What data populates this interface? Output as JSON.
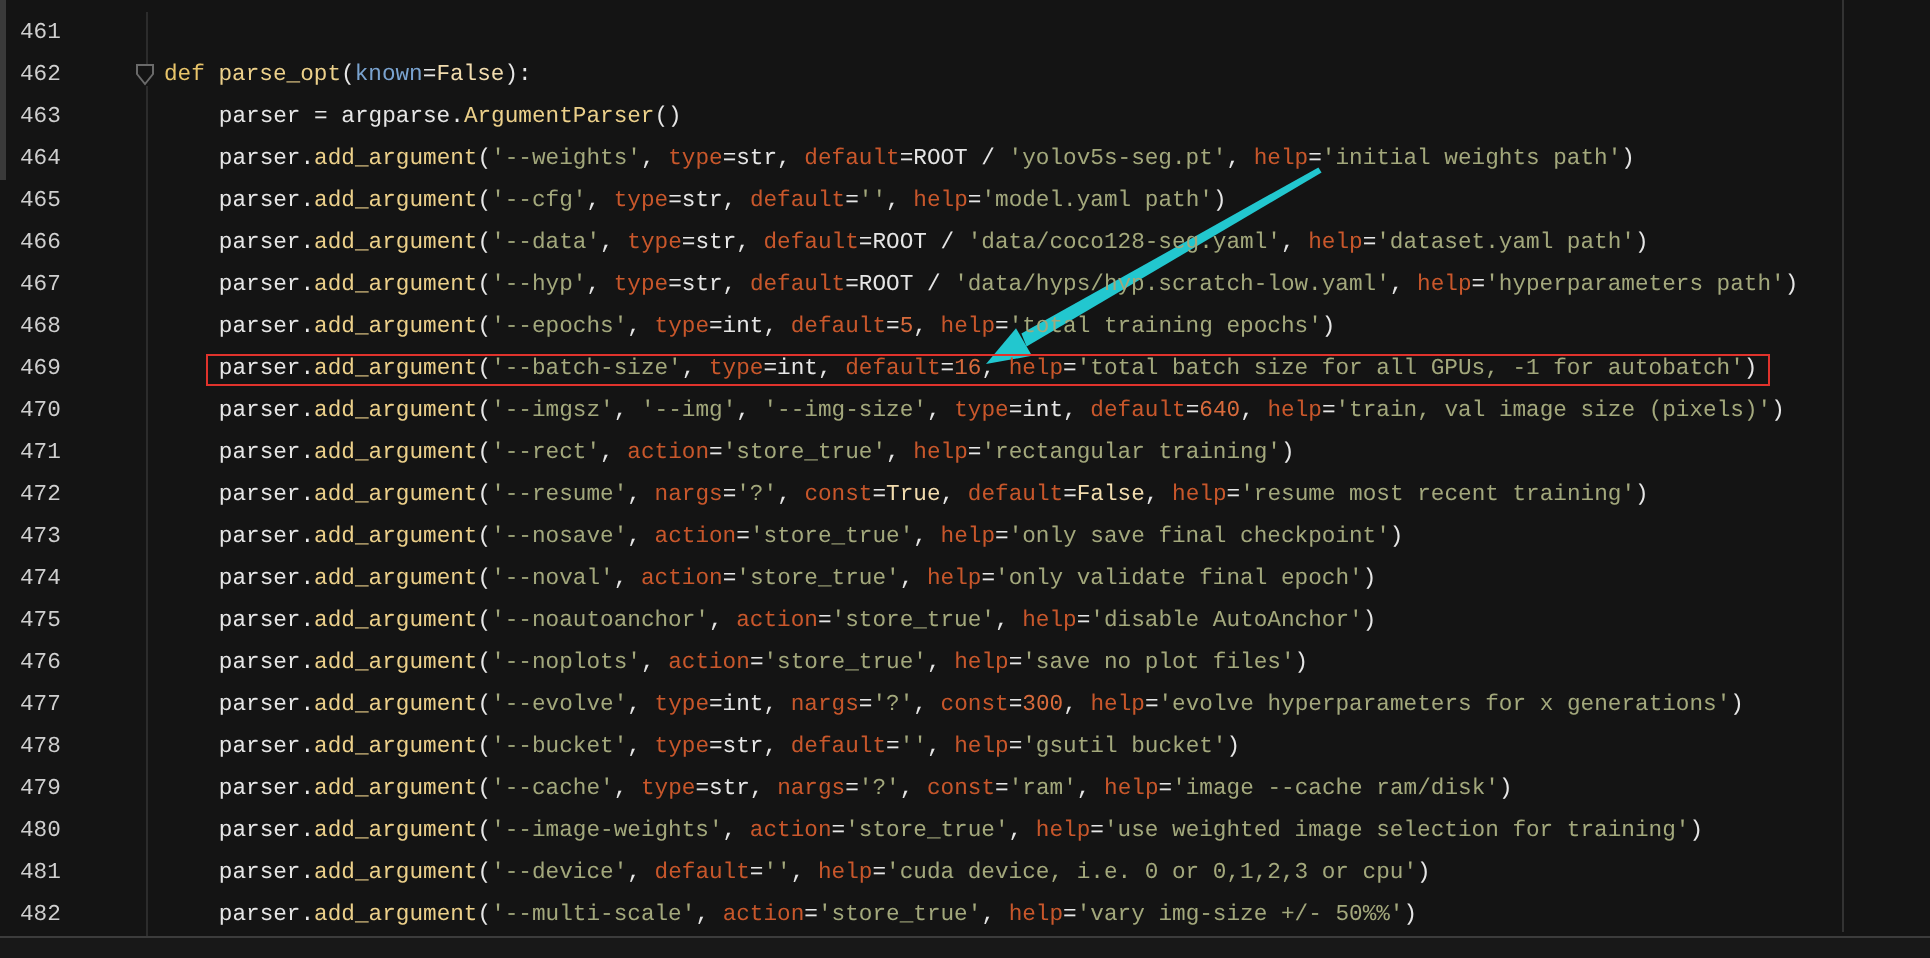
{
  "editor": {
    "lines": [
      {
        "number": "461"
      },
      {
        "number": "462",
        "highlighted": false,
        "foldable": true,
        "tokens": [
          {
            "kind": "keyword",
            "text": "def "
          },
          {
            "kind": "func",
            "text": "parse_opt"
          },
          {
            "kind": "plain",
            "text": "("
          },
          {
            "kind": "arg",
            "text": "known"
          },
          {
            "kind": "plain",
            "text": "="
          },
          {
            "kind": "const",
            "text": "False"
          },
          {
            "kind": "plain",
            "text": "):"
          }
        ],
        "children": [
          {
            "number": "463",
            "highlighted": false,
            "tokens": [
              {
                "kind": "plain",
                "text": "parser = argparse."
              },
              {
                "kind": "func",
                "text": "ArgumentParser"
              },
              {
                "kind": "plain",
                "text": "()"
              }
            ]
          },
          {
            "number": "464",
            "highlighted": false,
            "tokens": [
              {
                "kind": "plain",
                "text": "parser."
              },
              {
                "kind": "func",
                "text": "add_argument"
              },
              {
                "kind": "plain",
                "text": "("
              },
              {
                "kind": "string",
                "text": "'--weights'"
              },
              {
                "kind": "plain",
                "text": ", "
              },
              {
                "kind": "param",
                "text": "type"
              },
              {
                "kind": "plain",
                "text": "=str, "
              },
              {
                "kind": "param",
                "text": "default"
              },
              {
                "kind": "plain",
                "text": "=ROOT / "
              },
              {
                "kind": "string",
                "text": "'yolov5s-seg.pt'"
              },
              {
                "kind": "plain",
                "text": ", "
              },
              {
                "kind": "param",
                "text": "help"
              },
              {
                "kind": "plain",
                "text": "="
              },
              {
                "kind": "string",
                "text": "'initial weights path'"
              },
              {
                "kind": "plain",
                "text": ")"
              }
            ]
          },
          {
            "number": "465",
            "highlighted": false,
            "tokens": [
              {
                "kind": "plain",
                "text": "parser."
              },
              {
                "kind": "func",
                "text": "add_argument"
              },
              {
                "kind": "plain",
                "text": "("
              },
              {
                "kind": "string",
                "text": "'--cfg'"
              },
              {
                "kind": "plain",
                "text": ", "
              },
              {
                "kind": "param",
                "text": "type"
              },
              {
                "kind": "plain",
                "text": "=str, "
              },
              {
                "kind": "param",
                "text": "default"
              },
              {
                "kind": "plain",
                "text": "="
              },
              {
                "kind": "string",
                "text": "''"
              },
              {
                "kind": "plain",
                "text": ", "
              },
              {
                "kind": "param",
                "text": "help"
              },
              {
                "kind": "plain",
                "text": "="
              },
              {
                "kind": "string",
                "text": "'model.yaml path'"
              },
              {
                "kind": "plain",
                "text": ")"
              }
            ]
          },
          {
            "number": "466",
            "highlighted": false,
            "tokens": [
              {
                "kind": "plain",
                "text": "parser."
              },
              {
                "kind": "func",
                "text": "add_argument"
              },
              {
                "kind": "plain",
                "text": "("
              },
              {
                "kind": "string",
                "text": "'--data'"
              },
              {
                "kind": "plain",
                "text": ", "
              },
              {
                "kind": "param",
                "text": "type"
              },
              {
                "kind": "plain",
                "text": "=str, "
              },
              {
                "kind": "param",
                "text": "default"
              },
              {
                "kind": "plain",
                "text": "=ROOT / "
              },
              {
                "kind": "string",
                "text": "'data/coco128-seg.yaml'"
              },
              {
                "kind": "plain",
                "text": ", "
              },
              {
                "kind": "param",
                "text": "help"
              },
              {
                "kind": "plain",
                "text": "="
              },
              {
                "kind": "string",
                "text": "'dataset.yaml path'"
              },
              {
                "kind": "plain",
                "text": ")"
              }
            ]
          },
          {
            "number": "467",
            "highlighted": false,
            "tokens": [
              {
                "kind": "plain",
                "text": "parser."
              },
              {
                "kind": "func",
                "text": "add_argument"
              },
              {
                "kind": "plain",
                "text": "("
              },
              {
                "kind": "string",
                "text": "'--hyp'"
              },
              {
                "kind": "plain",
                "text": ", "
              },
              {
                "kind": "param",
                "text": "type"
              },
              {
                "kind": "plain",
                "text": "=str, "
              },
              {
                "kind": "param",
                "text": "default"
              },
              {
                "kind": "plain",
                "text": "=ROOT / "
              },
              {
                "kind": "string",
                "text": "'data/hyps/hyp.scratch-low.yaml'"
              },
              {
                "kind": "plain",
                "text": ", "
              },
              {
                "kind": "param",
                "text": "help"
              },
              {
                "kind": "plain",
                "text": "="
              },
              {
                "kind": "string",
                "text": "'hyperparameters path'"
              },
              {
                "kind": "plain",
                "text": ")"
              }
            ]
          },
          {
            "number": "468",
            "highlighted": false,
            "tokens": [
              {
                "kind": "plain",
                "text": "parser."
              },
              {
                "kind": "func",
                "text": "add_argument"
              },
              {
                "kind": "plain",
                "text": "("
              },
              {
                "kind": "string",
                "text": "'--epochs'"
              },
              {
                "kind": "plain",
                "text": ", "
              },
              {
                "kind": "param",
                "text": "type"
              },
              {
                "kind": "plain",
                "text": "=int, "
              },
              {
                "kind": "param",
                "text": "default"
              },
              {
                "kind": "plain",
                "text": "="
              },
              {
                "kind": "number",
                "text": "5"
              },
              {
                "kind": "plain",
                "text": ", "
              },
              {
                "kind": "param",
                "text": "help"
              },
              {
                "kind": "plain",
                "text": "="
              },
              {
                "kind": "string",
                "text": "'total training epochs'"
              },
              {
                "kind": "plain",
                "text": ")"
              }
            ]
          },
          {
            "number": "469",
            "highlighted": true,
            "tokens": [
              {
                "kind": "plain",
                "text": "parser."
              },
              {
                "kind": "func",
                "text": "add_argument"
              },
              {
                "kind": "plain",
                "text": "("
              },
              {
                "kind": "string",
                "text": "'--batch-size'"
              },
              {
                "kind": "plain",
                "text": ", "
              },
              {
                "kind": "param",
                "text": "type"
              },
              {
                "kind": "plain",
                "text": "=int, "
              },
              {
                "kind": "param",
                "text": "default"
              },
              {
                "kind": "plain",
                "text": "="
              },
              {
                "kind": "number",
                "text": "16"
              },
              {
                "kind": "plain",
                "text": ", "
              },
              {
                "kind": "param",
                "text": "help"
              },
              {
                "kind": "plain",
                "text": "="
              },
              {
                "kind": "string",
                "text": "'total batch size for all GPUs, -1 for autobatch'"
              },
              {
                "kind": "plain",
                "text": ")"
              }
            ]
          },
          {
            "number": "470",
            "highlighted": false,
            "tokens": [
              {
                "kind": "plain",
                "text": "parser."
              },
              {
                "kind": "func",
                "text": "add_argument"
              },
              {
                "kind": "plain",
                "text": "("
              },
              {
                "kind": "string",
                "text": "'--imgsz'"
              },
              {
                "kind": "plain",
                "text": ", "
              },
              {
                "kind": "string",
                "text": "'--img'"
              },
              {
                "kind": "plain",
                "text": ", "
              },
              {
                "kind": "string",
                "text": "'--img-size'"
              },
              {
                "kind": "plain",
                "text": ", "
              },
              {
                "kind": "param",
                "text": "type"
              },
              {
                "kind": "plain",
                "text": "=int, "
              },
              {
                "kind": "param",
                "text": "default"
              },
              {
                "kind": "plain",
                "text": "="
              },
              {
                "kind": "number",
                "text": "640"
              },
              {
                "kind": "plain",
                "text": ", "
              },
              {
                "kind": "param",
                "text": "help"
              },
              {
                "kind": "plain",
                "text": "="
              },
              {
                "kind": "string",
                "text": "'train, val image size (pixels)'"
              },
              {
                "kind": "plain",
                "text": ")"
              }
            ]
          },
          {
            "number": "471",
            "highlighted": false,
            "tokens": [
              {
                "kind": "plain",
                "text": "parser."
              },
              {
                "kind": "func",
                "text": "add_argument"
              },
              {
                "kind": "plain",
                "text": "("
              },
              {
                "kind": "string",
                "text": "'--rect'"
              },
              {
                "kind": "plain",
                "text": ", "
              },
              {
                "kind": "param",
                "text": "action"
              },
              {
                "kind": "plain",
                "text": "="
              },
              {
                "kind": "string",
                "text": "'store_true'"
              },
              {
                "kind": "plain",
                "text": ", "
              },
              {
                "kind": "param",
                "text": "help"
              },
              {
                "kind": "plain",
                "text": "="
              },
              {
                "kind": "string",
                "text": "'rectangular training'"
              },
              {
                "kind": "plain",
                "text": ")"
              }
            ]
          },
          {
            "number": "472",
            "highlighted": false,
            "tokens": [
              {
                "kind": "plain",
                "text": "parser."
              },
              {
                "kind": "func",
                "text": "add_argument"
              },
              {
                "kind": "plain",
                "text": "("
              },
              {
                "kind": "string",
                "text": "'--resume'"
              },
              {
                "kind": "plain",
                "text": ", "
              },
              {
                "kind": "param",
                "text": "nargs"
              },
              {
                "kind": "plain",
                "text": "="
              },
              {
                "kind": "string",
                "text": "'?'"
              },
              {
                "kind": "plain",
                "text": ", "
              },
              {
                "kind": "param",
                "text": "const"
              },
              {
                "kind": "plain",
                "text": "="
              },
              {
                "kind": "const",
                "text": "True"
              },
              {
                "kind": "plain",
                "text": ", "
              },
              {
                "kind": "param",
                "text": "default"
              },
              {
                "kind": "plain",
                "text": "="
              },
              {
                "kind": "const",
                "text": "False"
              },
              {
                "kind": "plain",
                "text": ", "
              },
              {
                "kind": "param",
                "text": "help"
              },
              {
                "kind": "plain",
                "text": "="
              },
              {
                "kind": "string",
                "text": "'resume most recent training'"
              },
              {
                "kind": "plain",
                "text": ")"
              }
            ]
          },
          {
            "number": "473",
            "highlighted": false,
            "tokens": [
              {
                "kind": "plain",
                "text": "parser."
              },
              {
                "kind": "func",
                "text": "add_argument"
              },
              {
                "kind": "plain",
                "text": "("
              },
              {
                "kind": "string",
                "text": "'--nosave'"
              },
              {
                "kind": "plain",
                "text": ", "
              },
              {
                "kind": "param",
                "text": "action"
              },
              {
                "kind": "plain",
                "text": "="
              },
              {
                "kind": "string",
                "text": "'store_true'"
              },
              {
                "kind": "plain",
                "text": ", "
              },
              {
                "kind": "param",
                "text": "help"
              },
              {
                "kind": "plain",
                "text": "="
              },
              {
                "kind": "string",
                "text": "'only save final checkpoint'"
              },
              {
                "kind": "plain",
                "text": ")"
              }
            ]
          },
          {
            "number": "474",
            "highlighted": false,
            "tokens": [
              {
                "kind": "plain",
                "text": "parser."
              },
              {
                "kind": "func",
                "text": "add_argument"
              },
              {
                "kind": "plain",
                "text": "("
              },
              {
                "kind": "string",
                "text": "'--noval'"
              },
              {
                "kind": "plain",
                "text": ", "
              },
              {
                "kind": "param",
                "text": "action"
              },
              {
                "kind": "plain",
                "text": "="
              },
              {
                "kind": "string",
                "text": "'store_true'"
              },
              {
                "kind": "plain",
                "text": ", "
              },
              {
                "kind": "param",
                "text": "help"
              },
              {
                "kind": "plain",
                "text": "="
              },
              {
                "kind": "string",
                "text": "'only validate final epoch'"
              },
              {
                "kind": "plain",
                "text": ")"
              }
            ]
          },
          {
            "number": "475",
            "highlighted": false,
            "tokens": [
              {
                "kind": "plain",
                "text": "parser."
              },
              {
                "kind": "func",
                "text": "add_argument"
              },
              {
                "kind": "plain",
                "text": "("
              },
              {
                "kind": "string",
                "text": "'--noautoanchor'"
              },
              {
                "kind": "plain",
                "text": ", "
              },
              {
                "kind": "param",
                "text": "action"
              },
              {
                "kind": "plain",
                "text": "="
              },
              {
                "kind": "string",
                "text": "'store_true'"
              },
              {
                "kind": "plain",
                "text": ", "
              },
              {
                "kind": "param",
                "text": "help"
              },
              {
                "kind": "plain",
                "text": "="
              },
              {
                "kind": "string",
                "text": "'disable AutoAnchor'"
              },
              {
                "kind": "plain",
                "text": ")"
              }
            ]
          },
          {
            "number": "476",
            "highlighted": false,
            "tokens": [
              {
                "kind": "plain",
                "text": "parser."
              },
              {
                "kind": "func",
                "text": "add_argument"
              },
              {
                "kind": "plain",
                "text": "("
              },
              {
                "kind": "string",
                "text": "'--noplots'"
              },
              {
                "kind": "plain",
                "text": ", "
              },
              {
                "kind": "param",
                "text": "action"
              },
              {
                "kind": "plain",
                "text": "="
              },
              {
                "kind": "string",
                "text": "'store_true'"
              },
              {
                "kind": "plain",
                "text": ", "
              },
              {
                "kind": "param",
                "text": "help"
              },
              {
                "kind": "plain",
                "text": "="
              },
              {
                "kind": "string",
                "text": "'save no plot files'"
              },
              {
                "kind": "plain",
                "text": ")"
              }
            ]
          },
          {
            "number": "477",
            "highlighted": false,
            "tokens": [
              {
                "kind": "plain",
                "text": "parser."
              },
              {
                "kind": "func",
                "text": "add_argument"
              },
              {
                "kind": "plain",
                "text": "("
              },
              {
                "kind": "string",
                "text": "'--evolve'"
              },
              {
                "kind": "plain",
                "text": ", "
              },
              {
                "kind": "param",
                "text": "type"
              },
              {
                "kind": "plain",
                "text": "=int, "
              },
              {
                "kind": "param",
                "text": "nargs"
              },
              {
                "kind": "plain",
                "text": "="
              },
              {
                "kind": "string",
                "text": "'?'"
              },
              {
                "kind": "plain",
                "text": ", "
              },
              {
                "kind": "param",
                "text": "const"
              },
              {
                "kind": "plain",
                "text": "="
              },
              {
                "kind": "number",
                "text": "300"
              },
              {
                "kind": "plain",
                "text": ", "
              },
              {
                "kind": "param",
                "text": "help"
              },
              {
                "kind": "plain",
                "text": "="
              },
              {
                "kind": "string",
                "text": "'evolve hyperparameters for x generations'"
              },
              {
                "kind": "plain",
                "text": ")"
              }
            ]
          },
          {
            "number": "478",
            "highlighted": false,
            "tokens": [
              {
                "kind": "plain",
                "text": "parser."
              },
              {
                "kind": "func",
                "text": "add_argument"
              },
              {
                "kind": "plain",
                "text": "("
              },
              {
                "kind": "string",
                "text": "'--bucket'"
              },
              {
                "kind": "plain",
                "text": ", "
              },
              {
                "kind": "param",
                "text": "type"
              },
              {
                "kind": "plain",
                "text": "=str, "
              },
              {
                "kind": "param",
                "text": "default"
              },
              {
                "kind": "plain",
                "text": "="
              },
              {
                "kind": "string",
                "text": "''"
              },
              {
                "kind": "plain",
                "text": ", "
              },
              {
                "kind": "param",
                "text": "help"
              },
              {
                "kind": "plain",
                "text": "="
              },
              {
                "kind": "string",
                "text": "'gsutil bucket'"
              },
              {
                "kind": "plain",
                "text": ")"
              }
            ]
          },
          {
            "number": "479",
            "highlighted": false,
            "tokens": [
              {
                "kind": "plain",
                "text": "parser."
              },
              {
                "kind": "func",
                "text": "add_argument"
              },
              {
                "kind": "plain",
                "text": "("
              },
              {
                "kind": "string",
                "text": "'--cache'"
              },
              {
                "kind": "plain",
                "text": ", "
              },
              {
                "kind": "param",
                "text": "type"
              },
              {
                "kind": "plain",
                "text": "=str, "
              },
              {
                "kind": "param",
                "text": "nargs"
              },
              {
                "kind": "plain",
                "text": "="
              },
              {
                "kind": "string",
                "text": "'?'"
              },
              {
                "kind": "plain",
                "text": ", "
              },
              {
                "kind": "param",
                "text": "const"
              },
              {
                "kind": "plain",
                "text": "="
              },
              {
                "kind": "string",
                "text": "'ram'"
              },
              {
                "kind": "plain",
                "text": ", "
              },
              {
                "kind": "param",
                "text": "help"
              },
              {
                "kind": "plain",
                "text": "="
              },
              {
                "kind": "string",
                "text": "'image --cache ram/disk'"
              },
              {
                "kind": "plain",
                "text": ")"
              }
            ]
          },
          {
            "number": "480",
            "highlighted": false,
            "tokens": [
              {
                "kind": "plain",
                "text": "parser."
              },
              {
                "kind": "func",
                "text": "add_argument"
              },
              {
                "kind": "plain",
                "text": "("
              },
              {
                "kind": "string",
                "text": "'--image-weights'"
              },
              {
                "kind": "plain",
                "text": ", "
              },
              {
                "kind": "param",
                "text": "action"
              },
              {
                "kind": "plain",
                "text": "="
              },
              {
                "kind": "string",
                "text": "'store_true'"
              },
              {
                "kind": "plain",
                "text": ", "
              },
              {
                "kind": "param",
                "text": "help"
              },
              {
                "kind": "plain",
                "text": "="
              },
              {
                "kind": "string",
                "text": "'use weighted image selection for training'"
              },
              {
                "kind": "plain",
                "text": ")"
              }
            ]
          },
          {
            "number": "481",
            "highlighted": false,
            "tokens": [
              {
                "kind": "plain",
                "text": "parser."
              },
              {
                "kind": "func",
                "text": "add_argument"
              },
              {
                "kind": "plain",
                "text": "("
              },
              {
                "kind": "string",
                "text": "'--device'"
              },
              {
                "kind": "plain",
                "text": ", "
              },
              {
                "kind": "param",
                "text": "default"
              },
              {
                "kind": "plain",
                "text": "="
              },
              {
                "kind": "string",
                "text": "''"
              },
              {
                "kind": "plain",
                "text": ", "
              },
              {
                "kind": "param",
                "text": "help"
              },
              {
                "kind": "plain",
                "text": "="
              },
              {
                "kind": "string",
                "text": "'cuda device, i.e. 0 or 0,1,2,3 or cpu'"
              },
              {
                "kind": "plain",
                "text": ")"
              }
            ]
          },
          {
            "number": "482",
            "highlighted": false,
            "tokens": [
              {
                "kind": "plain",
                "text": "parser."
              },
              {
                "kind": "func",
                "text": "add_argument"
              },
              {
                "kind": "plain",
                "text": "("
              },
              {
                "kind": "string",
                "text": "'--multi-scale'"
              },
              {
                "kind": "plain",
                "text": ", "
              },
              {
                "kind": "param",
                "text": "action"
              },
              {
                "kind": "plain",
                "text": "="
              },
              {
                "kind": "string",
                "text": "'store_true'"
              },
              {
                "kind": "plain",
                "text": ", "
              },
              {
                "kind": "param",
                "text": "help"
              },
              {
                "kind": "plain",
                "text": "="
              },
              {
                "kind": "string",
                "text": "'vary img-size +/- 50%%'"
              },
              {
                "kind": "plain",
                "text": ")"
              }
            ]
          }
        ]
      }
    ]
  }
}
